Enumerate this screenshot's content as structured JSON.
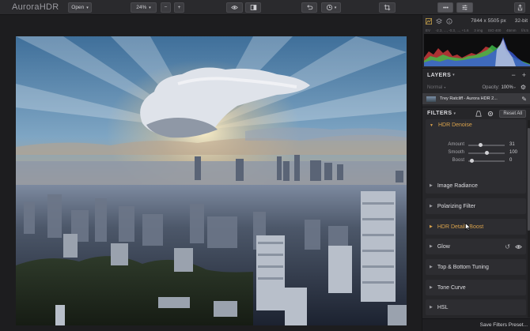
{
  "app": {
    "logo": "AuroraHDR"
  },
  "toolbar": {
    "open_label": "Open",
    "zoom_value": "24%",
    "zoom_out_symbol": "−",
    "zoom_in_symbol": "+"
  },
  "info": {
    "dimensions": "7844 x 5505 px",
    "bit_depth": "32-bit",
    "exif": [
      "EV",
      "-2.3, ..., -0.3, ..., +1.6",
      "3 img",
      "ISO 400",
      "45mm",
      "f/4.5"
    ]
  },
  "layers": {
    "title": "LAYERS",
    "minus_symbol": "−",
    "plus_symbol": "+",
    "blend_mode": "Normal",
    "opacity_label": "Opacity:",
    "opacity_value": "100%",
    "layer_name": "Trey Ratcliff - Aurora HDR 2..."
  },
  "filters": {
    "title": "FILTERS",
    "reset_label": "Reset All",
    "open_filter": {
      "name": "HDR Denoise",
      "sliders": [
        {
          "label": "Amount",
          "value": "31",
          "level": 0.31
        },
        {
          "label": "Smooth",
          "value": "100",
          "level": 0.5
        },
        {
          "label": "Boost",
          "value": "0",
          "level": 0.0
        }
      ]
    },
    "items": [
      {
        "name": "Image Radiance",
        "accent": false
      },
      {
        "name": "Polarizing Filter",
        "accent": false
      },
      {
        "name": "HDR Details Boost",
        "accent": true
      },
      {
        "name": "Glow",
        "accent": false
      },
      {
        "name": "Top & Bottom Tuning",
        "accent": false
      },
      {
        "name": "Tone Curve",
        "accent": false
      },
      {
        "name": "HSL",
        "accent": false
      }
    ],
    "save_label": "Save Filters Preset..."
  },
  "icons": {
    "histogram": "histogram-icon",
    "layers": "layers-icon",
    "info": "info-icon",
    "preview": "eye-icon",
    "compare": "compare-icon",
    "undo": "undo-icon",
    "history": "history-icon",
    "crop": "crop-icon",
    "share": "share-icon"
  },
  "colors": {
    "accent": "#d9a24c",
    "panel": "#262629"
  }
}
